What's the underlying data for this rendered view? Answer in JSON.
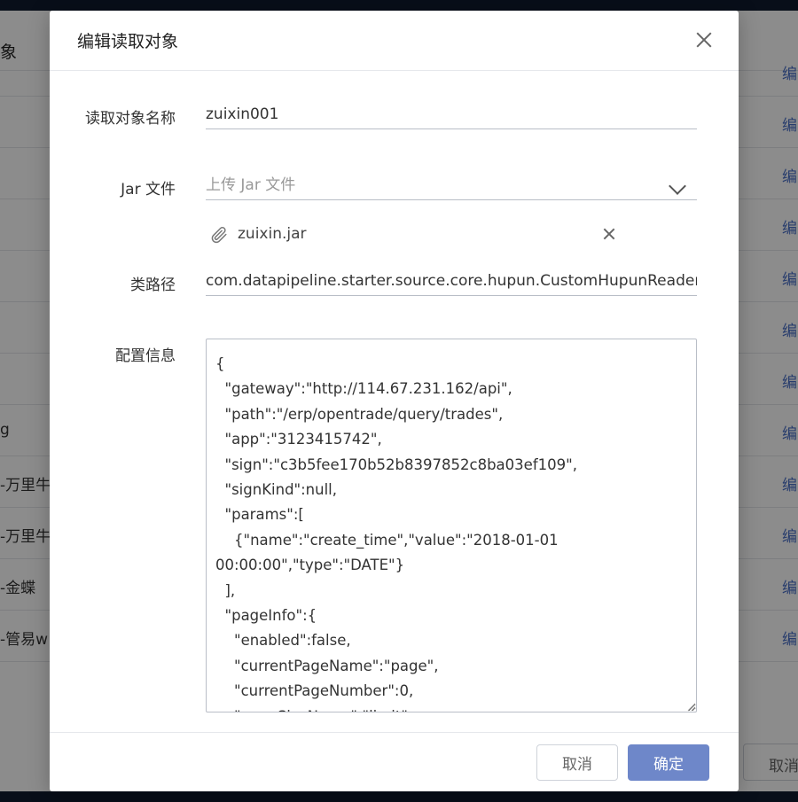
{
  "background": {
    "header_title": "象",
    "rows_left": [
      "",
      "",
      "",
      "",
      "",
      "",
      "g",
      "-万里牛",
      "-万里牛",
      "-金蝶",
      "-管易w"
    ],
    "rows_right": [
      "编",
      "编",
      "编",
      "编",
      "编",
      "编",
      "编",
      "编",
      "编",
      "编",
      "编",
      "编"
    ],
    "cancel_label": "取消"
  },
  "modal": {
    "title": "编辑读取对象",
    "name_label": "读取对象名称",
    "name_value": "zuixin001",
    "jar_label": "Jar 文件",
    "jar_placeholder": "上传 Jar 文件",
    "jar_file_name": "zuixin.jar",
    "classpath_label": "类路径",
    "classpath_value": "com.datapipeline.starter.source.core.hupun.CustomHupunReader",
    "config_label": "配置信息",
    "config_value": "{\n  \"gateway\":\"http://114.67.231.162/api\",\n  \"path\":\"/erp/opentrade/query/trades\",\n  \"app\":\"3123415742\",\n  \"sign\":\"c3b5fee170b52b8397852c8ba03ef109\",\n  \"signKind\":null,\n  \"params\":[\n    {\"name\":\"create_time\",\"value\":\"2018-01-01 00:00:00\",\"type\":\"DATE\"}\n  ],\n  \"pageInfo\":{\n    \"enabled\":false,\n    \"currentPageName\":\"page\",\n    \"currentPageNumber\":0,\n    \"pageSizeName\":\"limit\",",
    "cancel_label": "取消",
    "ok_label": "确定"
  },
  "colors": {
    "primary_button": "#6e87c9",
    "link": "#4a6fc7",
    "topbar": "#0f1a2e"
  }
}
